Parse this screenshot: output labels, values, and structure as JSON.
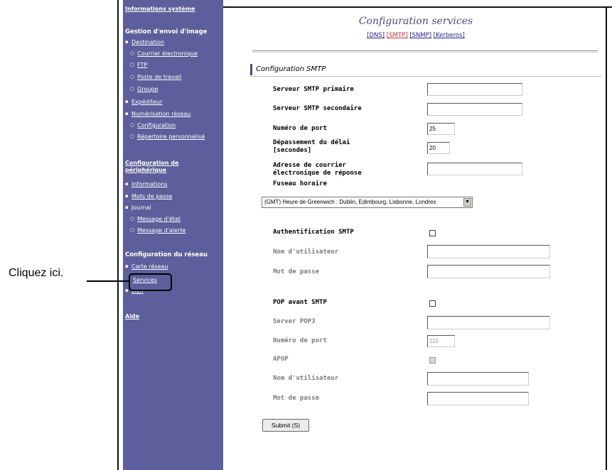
{
  "sidebar": {
    "system_info": "Informations système",
    "image_send": {
      "title": "Gestion d'envoi d'image",
      "destination": "Destination",
      "email": "Courrier électronique",
      "ftp": "FTP",
      "desktop": "Poste de travail",
      "group": "Groupe",
      "sender": "Expéditeur",
      "network_scan": "Numérisation réseau",
      "configuration": "Configuration",
      "personal_directory": "Répertoire personnalisé"
    },
    "device_config": {
      "title": "Configuration de périphérique",
      "information": "Informations",
      "passwords": "Mots de passe",
      "log": "Journal",
      "status_message": "Message d'état",
      "alert_message": "Message d'alerte"
    },
    "network_config": {
      "title": "Configuration du réseau",
      "network_card": "Carte réseau",
      "services": "Services",
      "link": "Lien"
    },
    "help": "Aide"
  },
  "callout": {
    "text": "Cliquez ici."
  },
  "main": {
    "title": "Configuration services",
    "tabs": [
      "[DNS]",
      "[SMTP]",
      "[SNMP]",
      "[Kerberos]"
    ],
    "active_tab": "[SMTP]",
    "section_title": "Configuration SMTP",
    "primary_smtp_label": "Serveur SMTP primaire",
    "primary_smtp_value": "",
    "secondary_smtp_label": "Serveur SMTP secondaire",
    "secondary_smtp_value": "",
    "port_label": "Numéro de port",
    "port_value": "25",
    "timeout_label_line1": "Dépassement du délai",
    "timeout_label_line2": "[secondes]",
    "timeout_value": "20",
    "reply_email_label_line1": "Adresse de courrier",
    "reply_email_label_line2": "électronique de réponse",
    "reply_email_value": "",
    "timezone_label": "Fuseau horaire",
    "timezone_value": "(GMT) Heure de Greenwich : Dublin, Edimbourg, Lisbonne, Londres",
    "smtp_auth_label": "Authentification SMTP",
    "smtp_auth_checked": false,
    "auth_username_label": "Nom d'utilisateur",
    "auth_username_value": "",
    "auth_password_label": "Mot de passe",
    "auth_password_value": "",
    "pop_before_smtp_label": "POP avant SMTP",
    "pop_before_smtp_checked": false,
    "pop3_server_label": "Server POP3",
    "pop3_server_value": "",
    "pop3_port_label": "Numéro de port",
    "pop3_port_value": "110",
    "apop_label": "APOP",
    "apop_checked": false,
    "pop_username_label": "Nom d'utilisateur",
    "pop_username_value": "",
    "pop_password_label": "Mot de passe",
    "pop_password_value": "",
    "submit_label": "Submit (S)"
  },
  "colors": {
    "sidebar_bg": "#5d5f9c",
    "title_color": "#4a4c86",
    "link_color": "#2424a0",
    "active_tab_color": "#e03030"
  }
}
